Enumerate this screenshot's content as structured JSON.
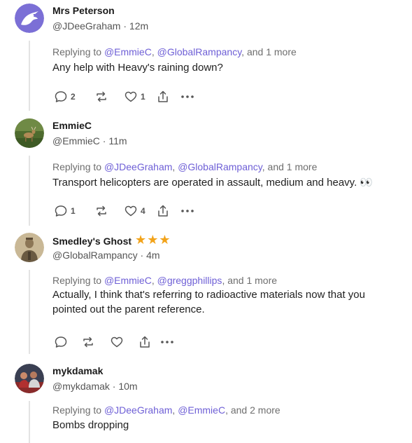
{
  "posts": [
    {
      "name": "Mrs Peterson",
      "handle": "@JDeeGraham",
      "time": "12m",
      "reply_prefix": "Replying to ",
      "mentions": [
        "@EmmieC",
        "@GlobalRampancy"
      ],
      "reply_suffix": ", and 1 more",
      "text": "Any help with Heavy's raining down?",
      "counts": {
        "replies": "2",
        "reposts": "",
        "likes": "1"
      },
      "stars": 0,
      "avatar_icon": "eagle-logo"
    },
    {
      "name": "EmmieC",
      "handle": "@EmmieC",
      "time": "11m",
      "reply_prefix": "Replying to ",
      "mentions": [
        "@JDeeGraham",
        "@GlobalRampancy"
      ],
      "reply_suffix": ", and 1 more",
      "text": "Transport helicopters are operated in assault, medium and heavy. 👀",
      "counts": {
        "replies": "1",
        "reposts": "",
        "likes": "4"
      },
      "stars": 0,
      "avatar_icon": "deer-photo"
    },
    {
      "name": "Smedley's Ghost",
      "handle": "@GlobalRampancy",
      "time": "4m",
      "reply_prefix": "Replying to ",
      "mentions": [
        "@EmmieC",
        "@greggphillips"
      ],
      "reply_suffix": ", and 1 more",
      "text": "Actually, I think that's referring to radioactive materials now that you pointed out the parent reference.",
      "counts": {
        "replies": "",
        "reposts": "",
        "likes": ""
      },
      "stars": 3,
      "avatar_icon": "soldier-portrait"
    },
    {
      "name": "mykdamak",
      "handle": "@mykdamak",
      "time": "10m",
      "reply_prefix": "Replying to ",
      "mentions": [
        "@JDeeGraham",
        "@EmmieC"
      ],
      "reply_suffix": ", and 2 more",
      "text": "Bombs dropping",
      "counts": {
        "replies": "",
        "reposts": "",
        "likes": ""
      },
      "stars": 0,
      "avatar_icon": "group-photo"
    }
  ],
  "meta_separator": " · ",
  "colors": {
    "mention": "#6e5fd6",
    "star": "#f2a31a",
    "thread_line": "#e3e3e3",
    "text": "#1f1f1f",
    "muted": "#6e6e6e"
  }
}
